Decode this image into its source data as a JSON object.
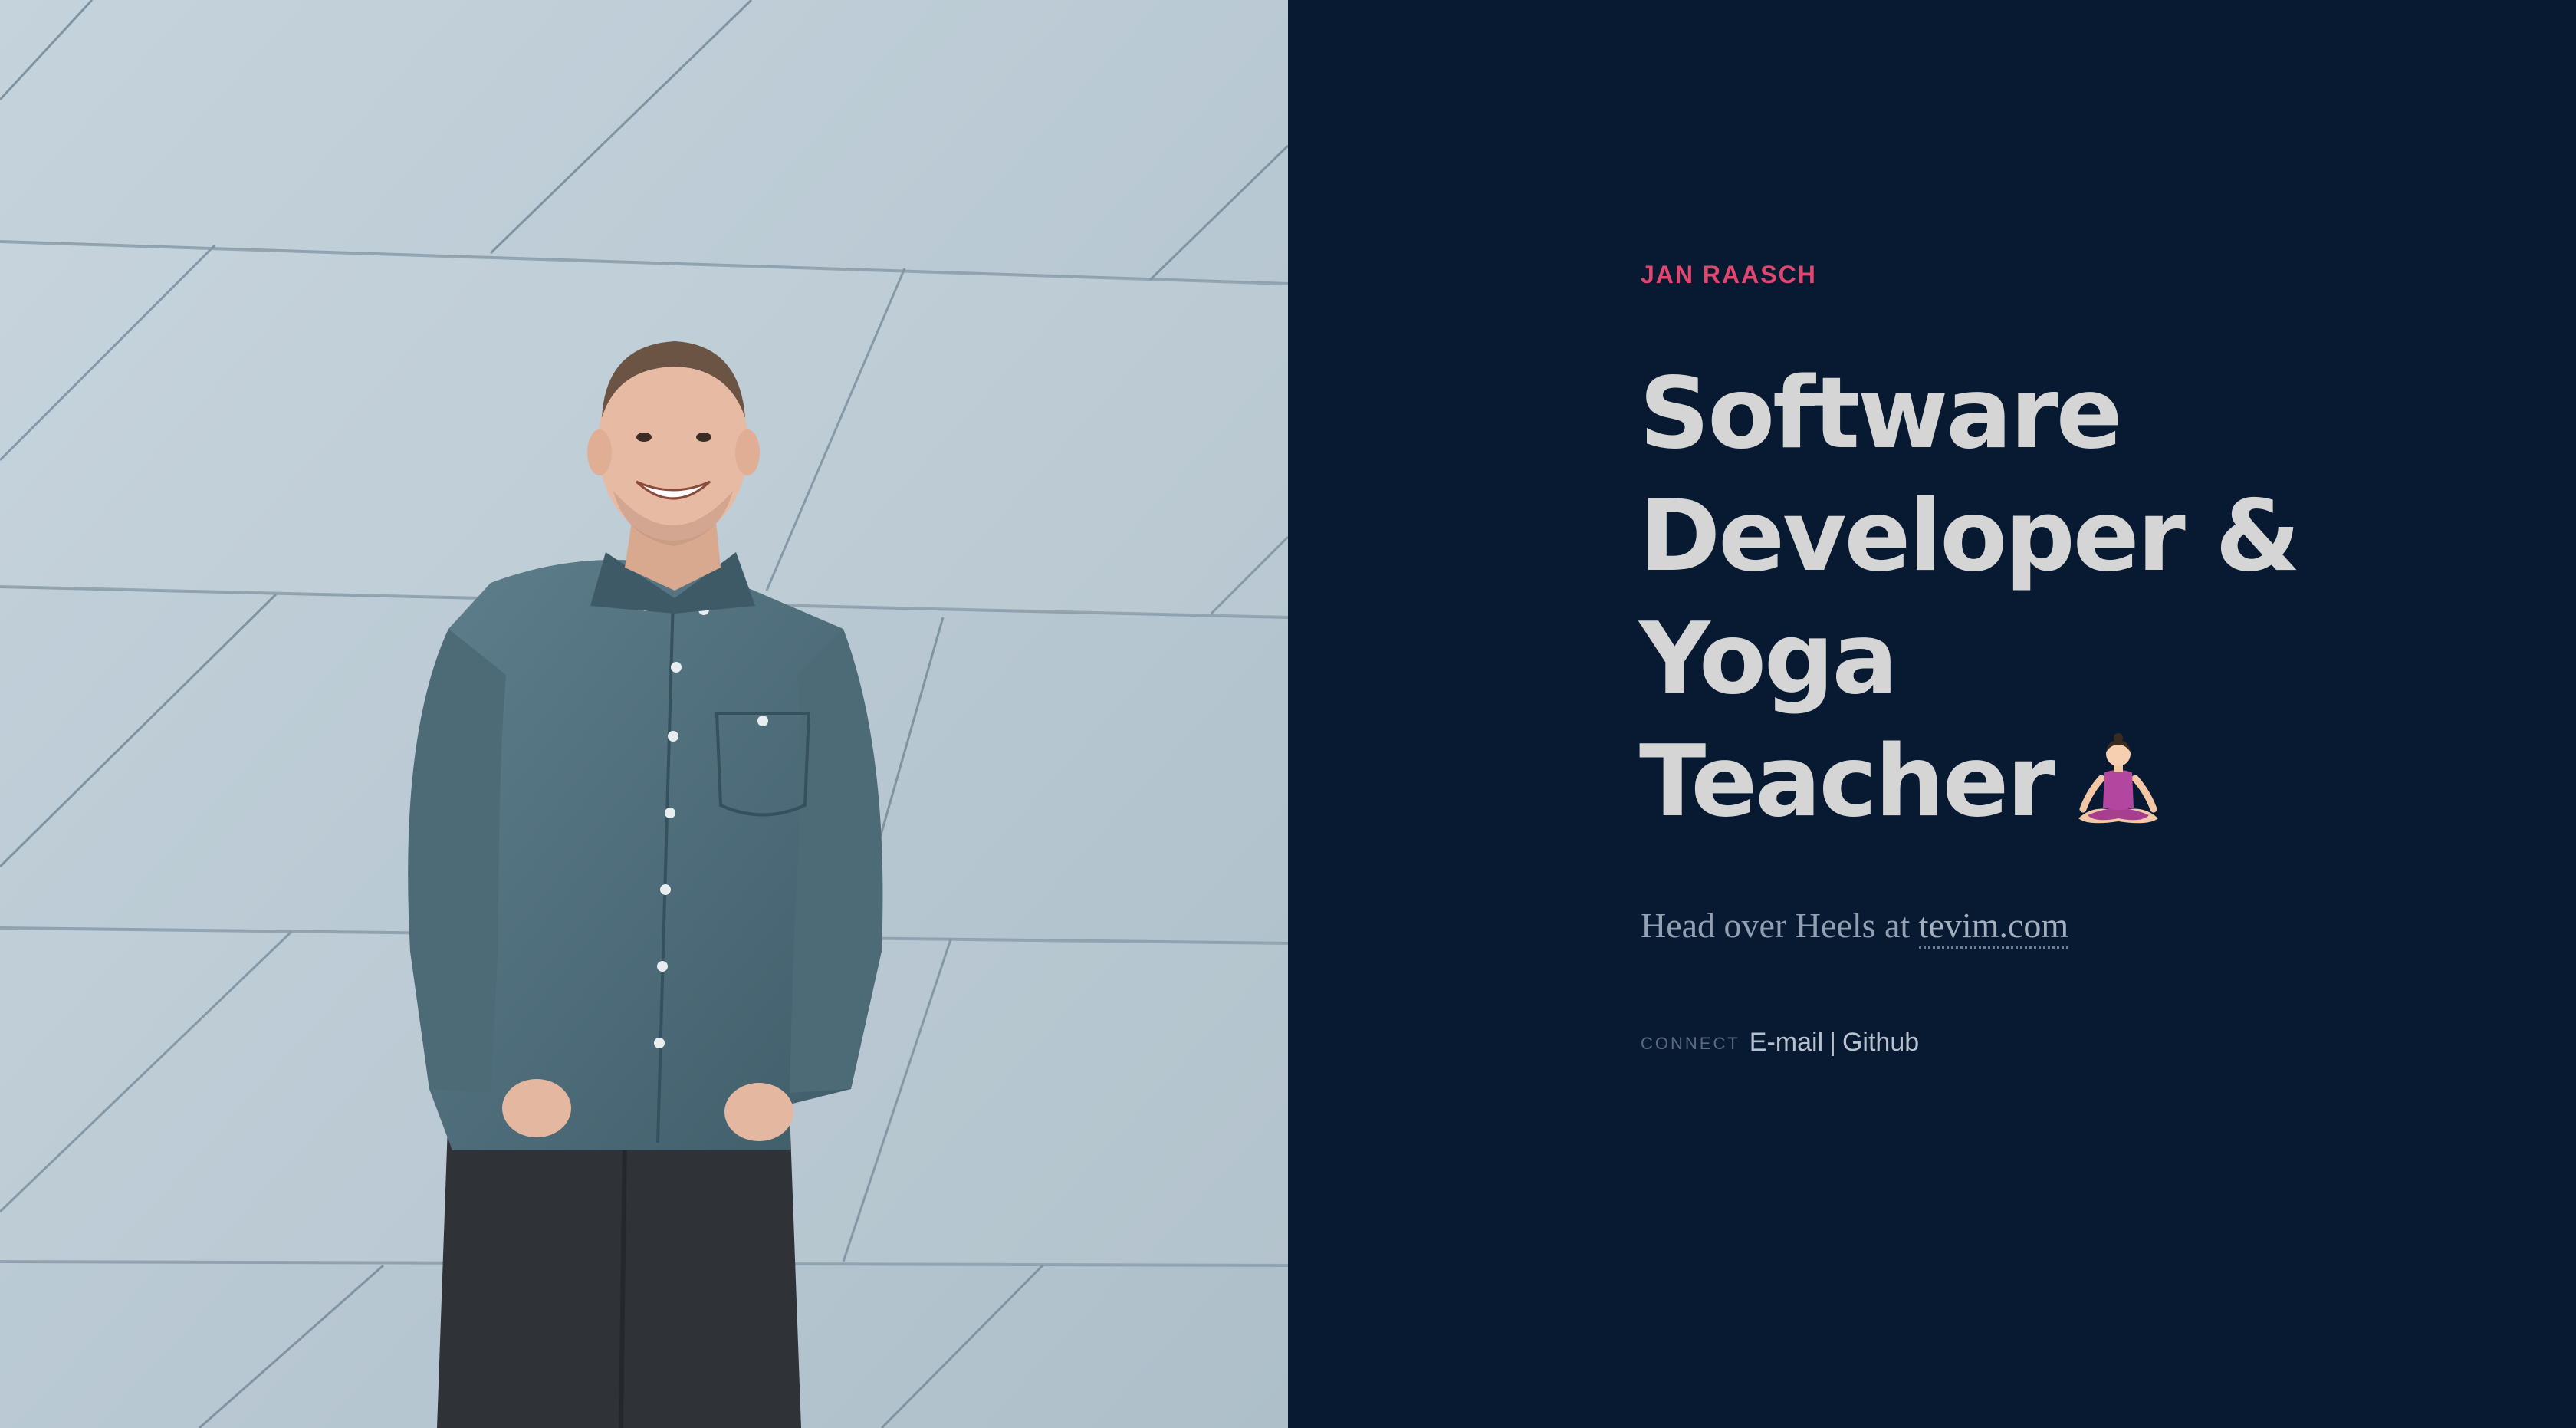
{
  "profile": {
    "name": "JAN RAASCH",
    "headline_lines": [
      "Software",
      "Developer &",
      "Yoga",
      "Teacher"
    ],
    "headline_emoji_icon": "person-in-lotus-position-icon"
  },
  "tagline": {
    "prefix": "Head over Heels at",
    "link_text": "tevim.com"
  },
  "connect": {
    "label": "CONNECT",
    "links": [
      "E-mail",
      "Github"
    ],
    "separator": "|"
  },
  "colors": {
    "background": "#071a31",
    "accent": "#e1466f",
    "headline": "#d5d5d5",
    "muted_text": "#93a0b2"
  }
}
